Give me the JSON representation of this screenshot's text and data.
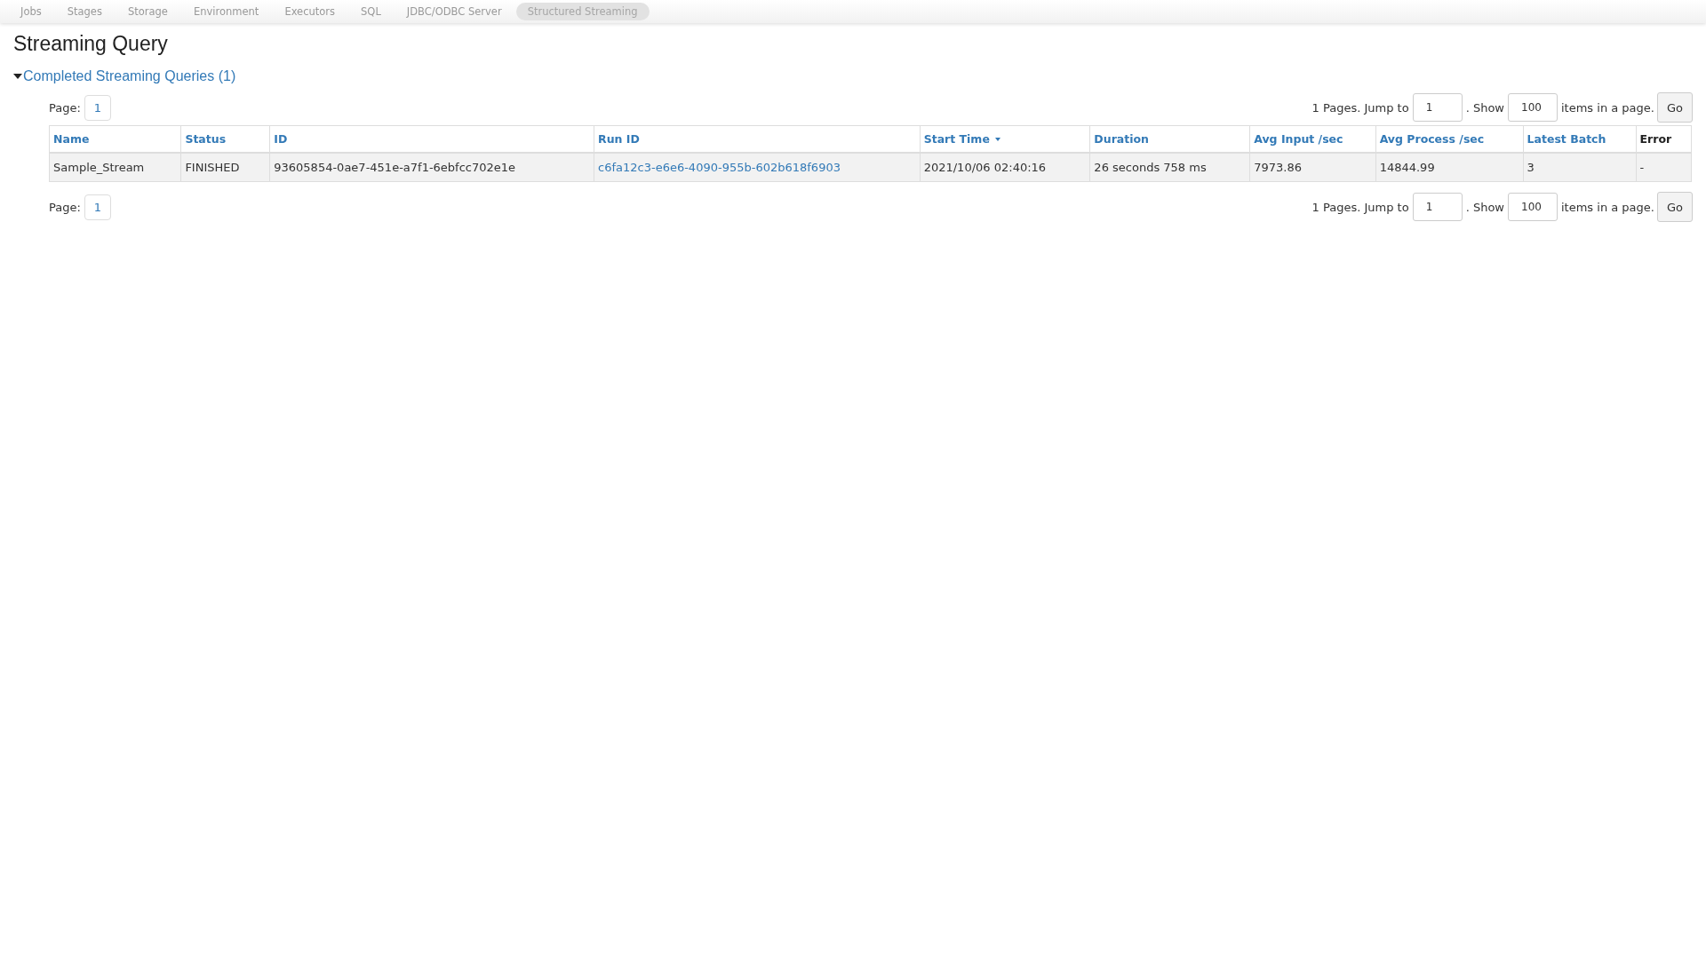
{
  "nav_tabs": [
    {
      "label": "Jobs",
      "selected": false
    },
    {
      "label": "Stages",
      "selected": false
    },
    {
      "label": "Storage",
      "selected": false
    },
    {
      "label": "Environment",
      "selected": false
    },
    {
      "label": "Executors",
      "selected": false
    },
    {
      "label": "SQL",
      "selected": false
    },
    {
      "label": "JDBC/ODBC Server",
      "selected": false
    },
    {
      "label": "Structured Streaming",
      "selected": true
    }
  ],
  "page_title": "Streaming Query",
  "section": {
    "title": "Completed Streaming Queries (1)",
    "expanded": true
  },
  "pagination_top": {
    "page_label": "Page:",
    "pages": [
      {
        "label": "1"
      }
    ],
    "pages_text": "1 Pages. Jump to",
    "jump_value": "1",
    "show_text": ". Show",
    "show_value": "100",
    "items_text": "items in a page.",
    "go_button": "Go"
  },
  "table": {
    "columns": [
      {
        "label": "Name",
        "sortable": true,
        "sorted": false
      },
      {
        "label": "Status",
        "sortable": true,
        "sorted": false
      },
      {
        "label": "ID",
        "sortable": true,
        "sorted": false
      },
      {
        "label": "Run ID",
        "sortable": true,
        "sorted": false
      },
      {
        "label": "Start Time",
        "sortable": true,
        "sorted": true
      },
      {
        "label": "Duration",
        "sortable": true,
        "sorted": false
      },
      {
        "label": "Avg Input /sec",
        "sortable": true,
        "sorted": false
      },
      {
        "label": "Avg Process /sec",
        "sortable": true,
        "sorted": false
      },
      {
        "label": "Latest Batch",
        "sortable": true,
        "sorted": false
      },
      {
        "label": "Error",
        "sortable": false,
        "sorted": false
      }
    ],
    "rows": [
      {
        "cells": [
          {
            "text": "Sample_Stream",
            "kind": "text"
          },
          {
            "text": "FINISHED",
            "kind": "text"
          },
          {
            "text": "93605854-0ae7-451e-a7f1-6ebfcc702e1e",
            "kind": "text"
          },
          {
            "text": "c6fa12c3-e6e6-4090-955b-602b618f6903",
            "kind": "link"
          },
          {
            "text": "2021/10/06 02:40:16",
            "kind": "text"
          },
          {
            "text": "26 seconds 758 ms",
            "kind": "text"
          },
          {
            "text": "7973.86",
            "kind": "text"
          },
          {
            "text": "14844.99",
            "kind": "text"
          },
          {
            "text": "3",
            "kind": "text"
          },
          {
            "text": "-",
            "kind": "text"
          }
        ]
      }
    ]
  },
  "pagination_bottom": {
    "page_label": "Page:",
    "pages": [
      {
        "label": "1"
      }
    ],
    "pages_text": "1 Pages. Jump to",
    "jump_value": "1",
    "show_text": ". Show",
    "show_value": "100",
    "items_text": "items in a page.",
    "go_button": "Go"
  }
}
